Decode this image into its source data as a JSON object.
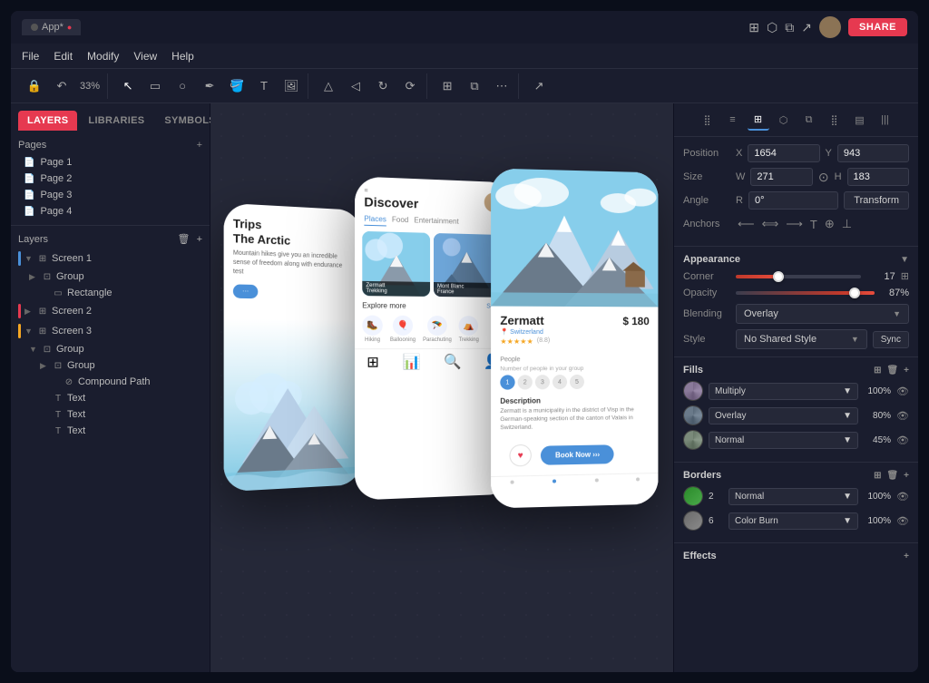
{
  "titlebar": {
    "app_name": "App*",
    "share_label": "SHARE",
    "tab_label": "App*"
  },
  "menu": {
    "items": [
      "File",
      "Edit",
      "Modify",
      "View",
      "Help"
    ]
  },
  "toolbar": {
    "zoom": "33%"
  },
  "sidebar": {
    "tabs": [
      "LAYERS",
      "LIBRARIES",
      "SYMBOLS"
    ],
    "active_tab": "LAYERS",
    "pages_label": "Pages",
    "pages": [
      "Page 1",
      "Page 2",
      "Page 3",
      "Page 4"
    ],
    "layers_label": "Layers",
    "layers": [
      {
        "name": "Screen 1",
        "indent": 0,
        "type": "screen",
        "color": "#4a90d9"
      },
      {
        "name": "Group",
        "indent": 1,
        "type": "group",
        "color": ""
      },
      {
        "name": "Rectangle",
        "indent": 2,
        "type": "rect",
        "color": ""
      },
      {
        "name": "Screen 2",
        "indent": 0,
        "type": "screen",
        "color": "#e63950"
      },
      {
        "name": "Screen 3",
        "indent": 0,
        "type": "screen",
        "color": "#f5a623"
      },
      {
        "name": "Group",
        "indent": 1,
        "type": "group",
        "color": ""
      },
      {
        "name": "Group",
        "indent": 2,
        "type": "group",
        "color": ""
      },
      {
        "name": "Compound Path",
        "indent": 3,
        "type": "path",
        "color": ""
      },
      {
        "name": "Text",
        "indent": 2,
        "type": "text",
        "color": ""
      },
      {
        "name": "Text",
        "indent": 2,
        "type": "text",
        "color": ""
      },
      {
        "name": "Text",
        "indent": 2,
        "type": "text",
        "color": ""
      }
    ]
  },
  "phone_left": {
    "title": "Trips",
    "subtitle": "The Arctic",
    "body": "Mountain hikes give you an incredible sense of freedom along with endurance test",
    "cta": "···"
  },
  "phone_center": {
    "title": "Discover",
    "tabs": [
      "Places",
      "Food",
      "Entertainment"
    ],
    "explore_label": "Explore more",
    "see_all": "See all",
    "activities": [
      "Hiking",
      "Ballooning",
      "Parachuting",
      "Trekking"
    ],
    "cards": [
      {
        "label": "Zermatt\nTrekking"
      },
      {
        "label": "Mont Blanc\nFrance"
      }
    ]
  },
  "phone_right": {
    "title": "Zermatt",
    "price": "$ 180",
    "location": "Switzerland",
    "rating": "★★★★★",
    "rating_count": "(8.8)",
    "people_label": "People",
    "people_sublabel": "Number of people in your group",
    "people": [
      "1",
      "2",
      "3",
      "4",
      "5"
    ],
    "desc_title": "Description",
    "desc_text": "Zermatt is a municipality in the district of Visp in the German-speaking section of the canton of Valais in Switzerland.",
    "book_btn": "Book Now  ›››"
  },
  "right_panel": {
    "position": {
      "label": "Position",
      "x_label": "X",
      "x_value": "1654",
      "y_label": "Y",
      "y_value": "943"
    },
    "size": {
      "label": "Size",
      "w_label": "W",
      "w_value": "271",
      "h_label": "H",
      "h_value": "183"
    },
    "angle": {
      "label": "Angle",
      "r_label": "R",
      "r_value": "0°",
      "transform_btn": "Transform"
    },
    "anchors_label": "Anchors",
    "appearance_label": "Appearance",
    "corner_label": "Corner",
    "corner_value": "17",
    "opacity_label": "Opacity",
    "opacity_value": "87%",
    "blending_label": "Blending",
    "blending_value": "Overlay",
    "style_label": "Style",
    "style_value": "No Shared Style",
    "sync_btn": "Sync",
    "fills_label": "Fills",
    "fills": [
      {
        "blend": "Multiply",
        "pct": "100%"
      },
      {
        "blend": "Overlay",
        "pct": "80%"
      },
      {
        "blend": "Normal",
        "pct": "45%"
      }
    ],
    "borders_label": "Borders",
    "borders": [
      {
        "num": "2",
        "blend": "Normal",
        "pct": "100%"
      },
      {
        "num": "6",
        "blend": "Color Burn",
        "pct": "100%"
      }
    ],
    "effects_label": "Effects"
  }
}
